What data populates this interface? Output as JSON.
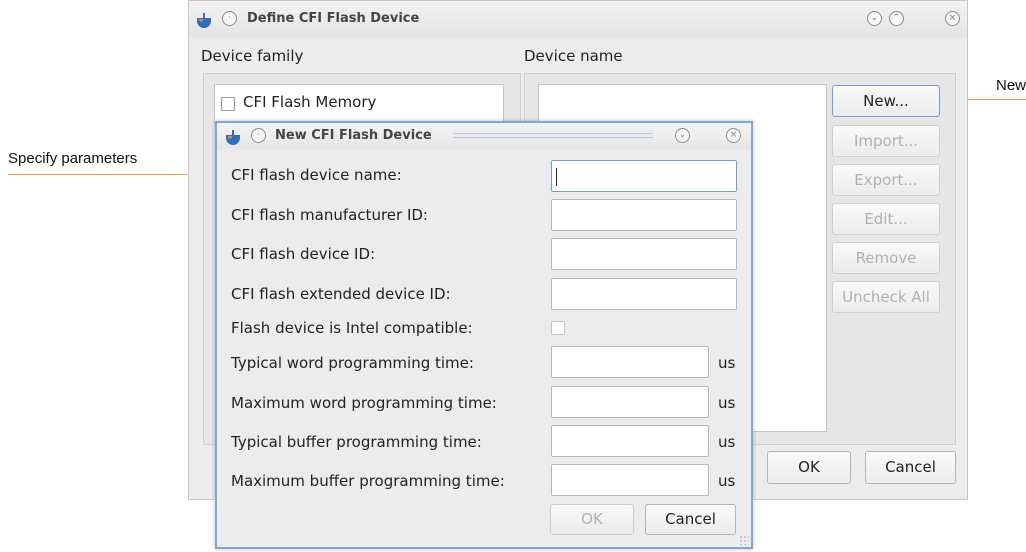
{
  "annotations": {
    "left_label": "Specify parameters",
    "right_label": "New",
    "arrow_color": "#f0a040"
  },
  "outer_dialog": {
    "title": "Define CFI Flash Device",
    "device_family_label": "Device family",
    "device_name_label": "Device name",
    "family_items": [
      {
        "label": "CFI Flash Memory",
        "checked": false
      }
    ],
    "buttons": {
      "new": "New...",
      "import": "Import...",
      "export": "Export...",
      "edit": "Edit...",
      "remove": "Remove",
      "uncheck_all": "Uncheck All",
      "ok": "OK",
      "cancel": "Cancel"
    }
  },
  "inner_dialog": {
    "title": "New CFI Flash Device",
    "fields": {
      "device_name": {
        "label": "CFI flash device name:",
        "value": ""
      },
      "manufacturer_id": {
        "label": "CFI flash manufacturer ID:",
        "value": ""
      },
      "device_id": {
        "label": "CFI flash device ID:",
        "value": ""
      },
      "extended_device_id": {
        "label": "CFI flash extended device ID:",
        "value": ""
      },
      "intel_compatible": {
        "label": "Flash device is Intel compatible:",
        "checked": false
      },
      "typical_word_time": {
        "label": "Typical word programming time:",
        "value": "",
        "unit": "us"
      },
      "maximum_word_time": {
        "label": "Maximum word programming time:",
        "value": "",
        "unit": "us"
      },
      "typical_buffer_time": {
        "label": "Typical buffer programming time:",
        "value": "",
        "unit": "us"
      },
      "maximum_buffer_time": {
        "label": "Maximum buffer programming time:",
        "value": "",
        "unit": "us"
      }
    },
    "buttons": {
      "ok": "OK",
      "cancel": "Cancel"
    }
  },
  "colors": {
    "accent_blue": "#6f9fd6",
    "window_bg": "#ececec",
    "title_icon_blue": "#2b6fc4",
    "title_icon_orange": "#e8801f"
  },
  "icons": [
    "app-logo-icon",
    "window-menu-icon",
    "minimize-icon",
    "maximize-icon",
    "close-icon"
  ]
}
